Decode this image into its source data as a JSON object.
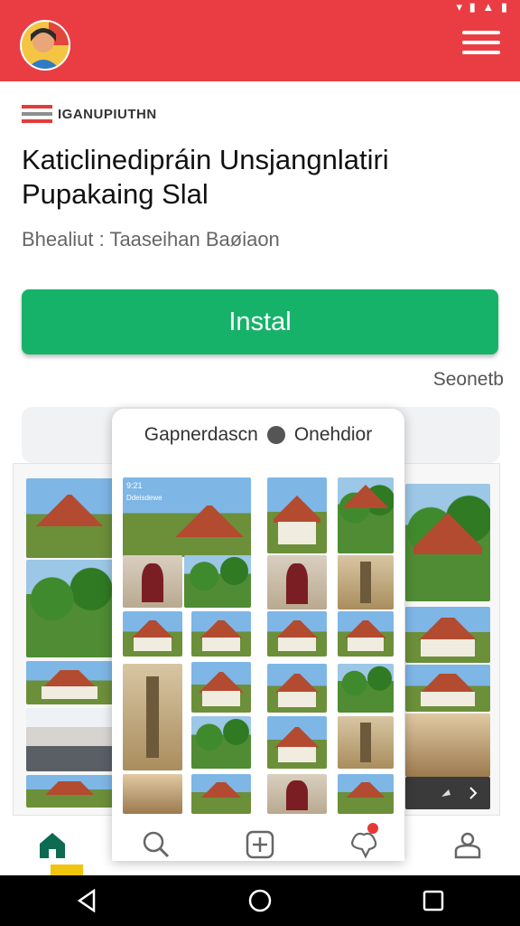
{
  "status": {
    "icons": "▾ ▮ ▲ ▮"
  },
  "header": {
    "menu_icon": "hamburger-icon",
    "avatar_icon": "avatar-icon"
  },
  "brand": {
    "name": "IGANUPIUTHN"
  },
  "app": {
    "title_line1": "Katiclinedipráin Unsjangnlatiri",
    "title_line2": "Pupakaing Slal",
    "subtitle": "Bhealiut : Taaseihan Baøiaon"
  },
  "install_button": {
    "label": "Instal",
    "color": "#17b26a"
  },
  "see_more": {
    "label": "Seonetb"
  },
  "screenshot_card": {
    "title": "Gapnerdascn",
    "title_suffix": "Onehdior"
  },
  "phone_overlay": {
    "time": "9:21",
    "label": "Ddeisdewe"
  },
  "bottom_nav": {
    "items": [
      {
        "name": "home",
        "icon": "home-icon",
        "active": true
      },
      {
        "name": "search",
        "icon": "search-icon",
        "active": false
      },
      {
        "name": "add",
        "icon": "plus-icon",
        "active": false
      },
      {
        "name": "notifications",
        "icon": "notification-icon",
        "active": false
      },
      {
        "name": "profile",
        "icon": "profile-icon",
        "active": false
      }
    ]
  },
  "colors": {
    "header": "#ea3d43",
    "accent": "#17b26a",
    "nav_active": "#0c6b50"
  }
}
